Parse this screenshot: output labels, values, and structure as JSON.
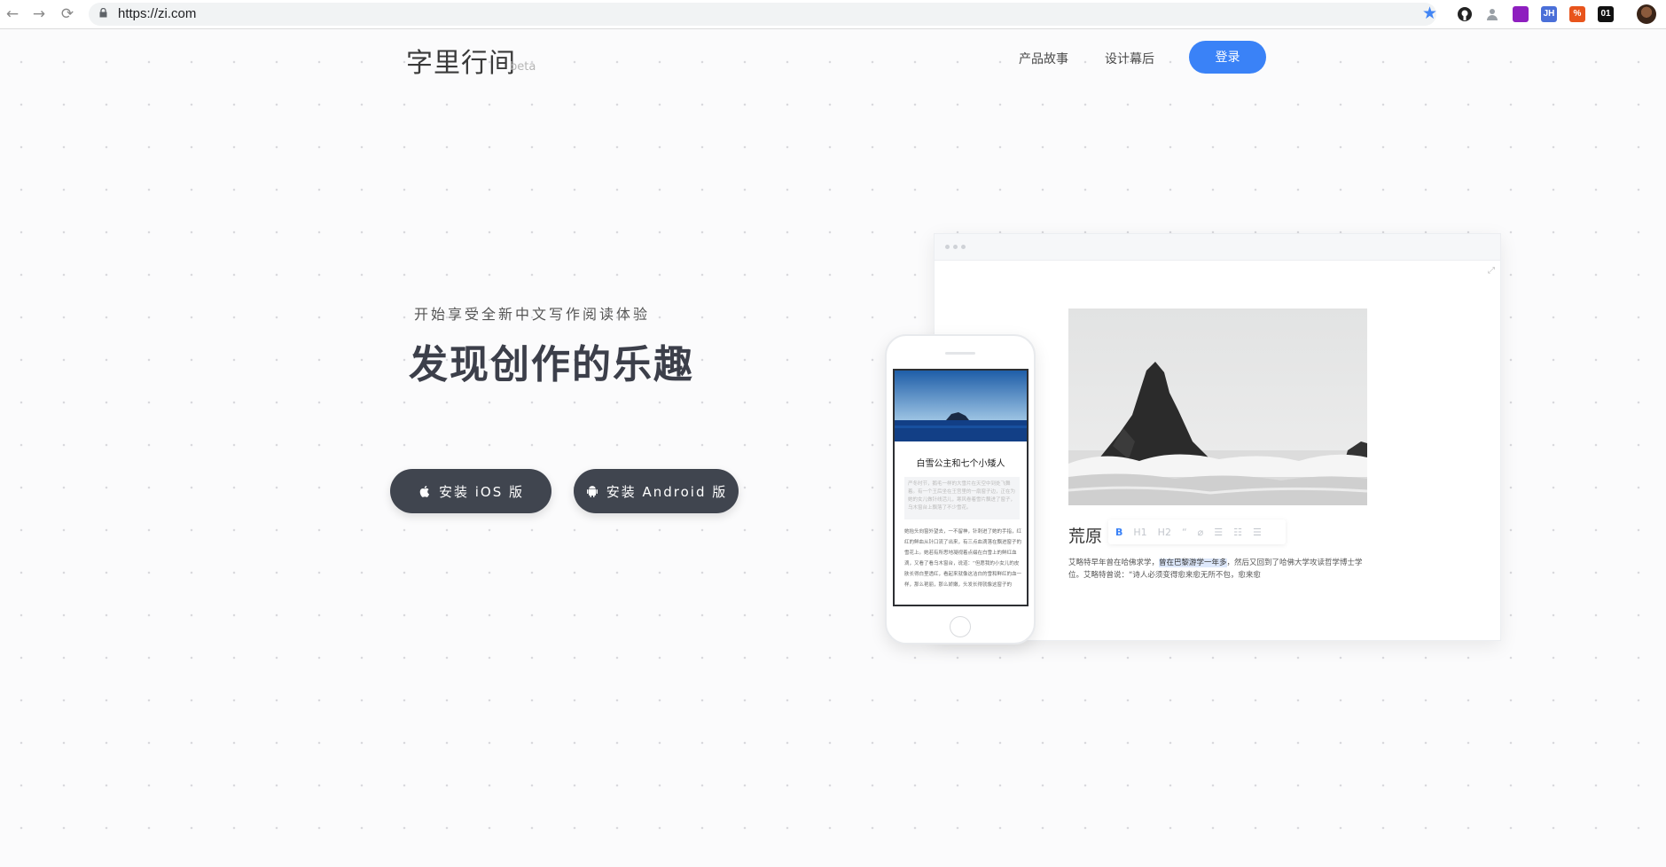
{
  "browser": {
    "url": "https://zi.com",
    "back_icon": "←",
    "forward_icon": "→",
    "reload_icon": "⟳",
    "bookmark_icon": "★",
    "extensions": [
      {
        "name": "github-extension-icon",
        "label": "",
        "color": "#222222"
      },
      {
        "name": "person-extension-icon",
        "label": "",
        "color": "#9aa0a6"
      },
      {
        "name": "purple-extension-icon",
        "label": "",
        "color": "#8e1fbf"
      },
      {
        "name": "jh-extension-icon",
        "label": "JH",
        "color": "#4a6fd8"
      },
      {
        "name": "percent-extension-icon",
        "label": "%",
        "color": "#e8541c"
      },
      {
        "name": "zero-one-extension-icon",
        "label": "01",
        "color": "#111111"
      }
    ]
  },
  "header": {
    "logo": "字里行间",
    "beta": "beta",
    "nav": [
      "产品故事",
      "设计幕后"
    ],
    "login": "登录"
  },
  "hero": {
    "subtitle": "开始享受全新中文写作阅读体验",
    "headline": "发现创作的乐趣",
    "ios_button": "安装 iOS 版",
    "android_button": "安装 Android 版"
  },
  "desktop_mock": {
    "title": "荒原",
    "toolbar": [
      "B",
      "H1",
      "H2",
      "“",
      "⌀",
      "☰",
      "☷",
      "☰"
    ],
    "body_pre": "艾略特早年曾在哈佛求学，",
    "body_highlight": "曾在巴黎游学一年多",
    "body_post": "，然后又回到了哈佛大学攻读哲学博士学位。艾略特曾说：“诗人必须变得愈来愈无所不包，愈来愈"
  },
  "phone_mock": {
    "title": "白雪公主和七个小矮人",
    "quote": "严冬时节，鹅毛一样的大雪片在天空中到处飞舞着。有一个王后坐在王宫里的一扇窗子边，正在为她的女儿做针线活儿，寒风卷着雪片飘进了窗子，乌木窗台上飘落了不少雪花。",
    "body": "她抬头向窗外望去，一不留神，针刺进了她的手指，红红的鲜血从针口流了出来，有三点血滴落在飘进窗子的雪花上。她若有所思地凝视着点缀在白雪上的鲜红血滴，又看了看乌木窗台，说道：“但愿我的小女儿的皮肤长得白里透红，看起来就像这洁白的雪和鲜红的血一样，那么艳丽，那么娇嫩，头发长得就像这窗子的"
  }
}
